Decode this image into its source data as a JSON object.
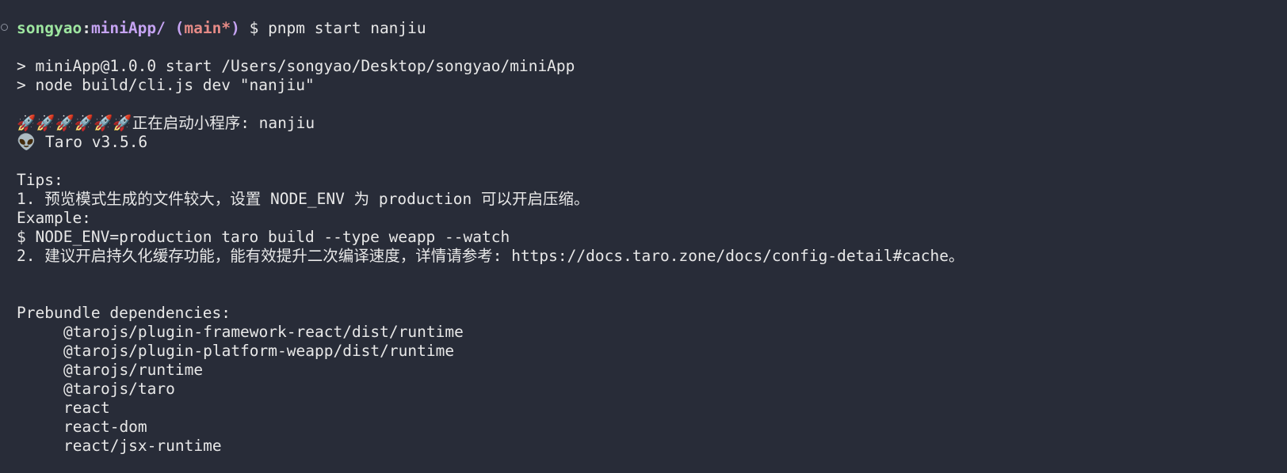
{
  "prompt": {
    "user": "songyao",
    "sep": ":",
    "dir": "miniApp/",
    "branch_open": "(",
    "branch": "main*",
    "branch_close": ")",
    "symbol": "$",
    "command": "pnpm start nanjiu"
  },
  "script_lines": [
    "> miniApp@1.0.0 start /Users/songyao/Desktop/songyao/miniApp",
    "> node build/cli.js dev \"nanjiu\""
  ],
  "launch": {
    "rockets": "🚀🚀🚀🚀🚀🚀",
    "text": "正在启动小程序: nanjiu"
  },
  "version": {
    "alien": "👽",
    "text": "Taro v3.5.6"
  },
  "tips": [
    "Tips:",
    "1. 预览模式生成的文件较大，设置 NODE_ENV 为 production 可以开启压缩。",
    "Example:",
    "$ NODE_ENV=production taro build --type weapp --watch",
    "2. 建议开启持久化缓存功能，能有效提升二次编译速度，详情请参考: https://docs.taro.zone/docs/config-detail#cache。"
  ],
  "prebundle": {
    "title": "Prebundle dependencies:",
    "deps": [
      "@tarojs/plugin-framework-react/dist/runtime",
      "@tarojs/plugin-platform-weapp/dist/runtime",
      "@tarojs/runtime",
      "@tarojs/taro",
      "react",
      "react-dom",
      "react/jsx-runtime"
    ]
  },
  "colors": {
    "background": "#282c38",
    "text": "#e8e8e8",
    "user": "#9ee6a0",
    "path": "#c5a3f2",
    "branch": "#e58a86"
  }
}
